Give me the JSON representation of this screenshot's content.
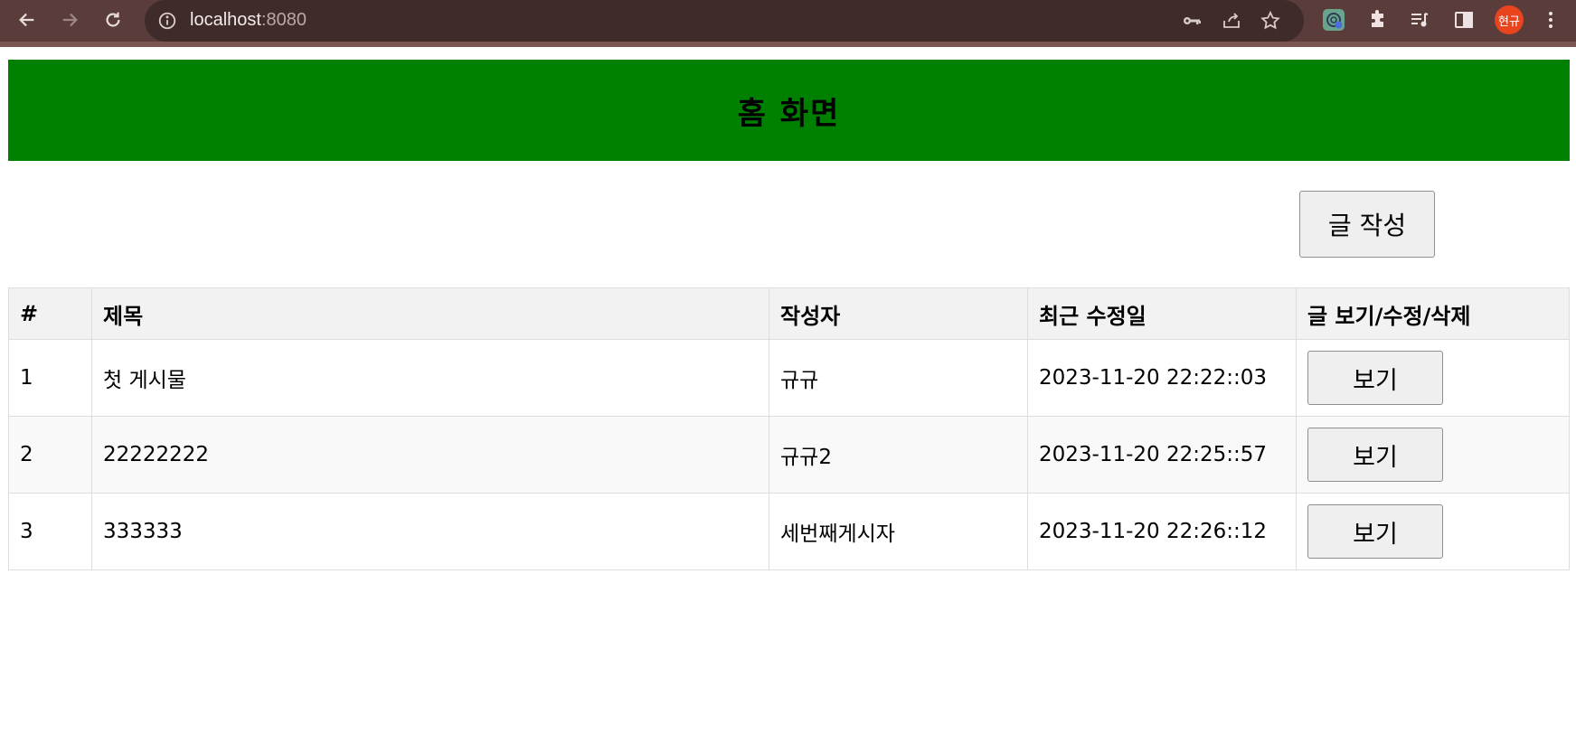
{
  "browser": {
    "url_host": "localhost",
    "url_port": ":8080",
    "profile_initials": "현규"
  },
  "page": {
    "title": "홈 화면",
    "write_button": "글 작성"
  },
  "table": {
    "headers": [
      "#",
      "제목",
      "작성자",
      "최근 수정일",
      "글 보기/수정/삭제"
    ],
    "rows": [
      {
        "num": "1",
        "title": "첫 게시물",
        "author": "규규",
        "modified": "2023-11-20 22:22::03",
        "action": "보기"
      },
      {
        "num": "2",
        "title": "22222222",
        "author": "규규2",
        "modified": "2023-11-20 22:25::57",
        "action": "보기"
      },
      {
        "num": "3",
        "title": "333333",
        "author": "세번째게시자",
        "modified": "2023-11-20 22:26::12",
        "action": "보기"
      }
    ]
  },
  "colors": {
    "header_bg": "#008000",
    "browser_bar": "#5a3d3b",
    "avatar": "#e8441e"
  }
}
